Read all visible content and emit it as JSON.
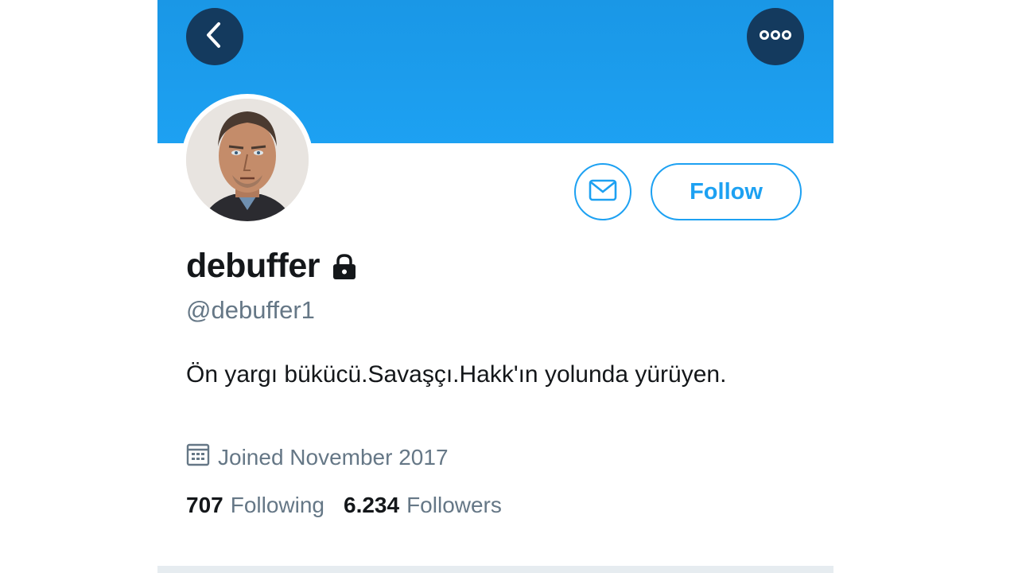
{
  "header": {
    "back_icon": "chevron-left-icon",
    "more_icon": "more-horizontal-icon",
    "banner_color": "#1da1f2",
    "button_color": "#143a5e"
  },
  "profile": {
    "display_name": "debuffer",
    "handle": "@debuffer1",
    "protected_icon": "lock-icon",
    "bio": "Ön yargı bükücü.Savaşçı.Hakk'ın yolunda yürüyen.",
    "joined": "Joined November 2017",
    "joined_icon": "calendar-icon"
  },
  "actions": {
    "message_icon": "envelope-icon",
    "follow_label": "Follow",
    "accent_color": "#1da1f2"
  },
  "stats": {
    "following_count": "707",
    "following_label": "Following",
    "followers_count": "6.234",
    "followers_label": "Followers"
  }
}
